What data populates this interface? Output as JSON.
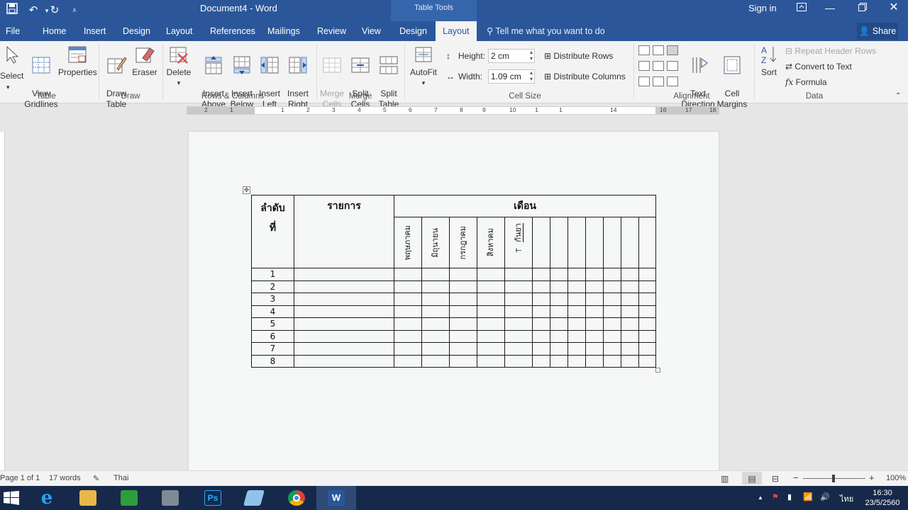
{
  "title_bar": {
    "doc_title": "Document4  -  Word",
    "contextual_label": "Table Tools",
    "signin": "Sign in"
  },
  "tabs": [
    "File",
    "Home",
    "Insert",
    "Design",
    "Layout",
    "References",
    "Mailings",
    "Review",
    "View",
    "Design",
    "Layout"
  ],
  "active_tab": "Layout",
  "tell_me": "Tell me what you want to do",
  "share": "Share",
  "ribbon": {
    "table": {
      "group": "Table",
      "select": "Select",
      "view_gridlines": "View\nGridlines",
      "properties": "Properties"
    },
    "draw": {
      "group": "Draw",
      "draw_table": "Draw\nTable",
      "eraser": "Eraser"
    },
    "rows_cols": {
      "group": "Rows & Columns",
      "delete": "Delete",
      "insert_above": "Insert\nAbove",
      "insert_below": "Insert\nBelow",
      "insert_left": "Insert\nLeft",
      "insert_right": "Insert\nRight"
    },
    "merge": {
      "group": "Merge",
      "merge_cells": "Merge\nCells",
      "split_cells": "Split\nCells",
      "split_table": "Split\nTable"
    },
    "cell_size": {
      "group": "Cell Size",
      "autofit": "AutoFit",
      "height_label": "Height:",
      "height_value": "2 cm",
      "width_label": "Width:",
      "width_value": "1.09 cm",
      "distribute_rows": "Distribute Rows",
      "distribute_columns": "Distribute Columns"
    },
    "alignment": {
      "group": "Alignment",
      "text_direction": "Text\nDirection",
      "cell_margins": "Cell\nMargins"
    },
    "data": {
      "group": "Data",
      "sort": "Sort",
      "repeat_header_rows": "Repeat Header Rows",
      "convert_to_text": "Convert to Text",
      "formula": "Formula"
    }
  },
  "ruler_marks": [
    "2",
    "1",
    "1",
    "2",
    "3",
    "4",
    "5",
    "6",
    "7",
    "8",
    "9",
    "10",
    "1",
    "1",
    "14",
    "16",
    "17",
    "18"
  ],
  "table": {
    "col1_header": "ลำดับ\nที่",
    "col2_header": "รายการ",
    "month_header": "เดือน",
    "month_subheaders": [
      "พฤษภาคม",
      "มิถุนายน",
      "กรกฎาคม",
      "สิงหาคม",
      "กันยา"
    ],
    "rows": [
      "1",
      "2",
      "3",
      "4",
      "5",
      "6",
      "7",
      "8"
    ]
  },
  "status_bar": {
    "page": "Page 1 of 1",
    "words": "17 words",
    "language": "Thai",
    "zoom": "100%"
  },
  "taskbar": {
    "apps": [
      "start-icon",
      "internet-explorer-icon",
      "file-explorer-icon",
      "store-icon",
      "calculator-icon",
      "photoshop-icon",
      "app-icon",
      "chrome-icon",
      "word-icon"
    ],
    "ime": "ไทย",
    "time": "16:30",
    "date": "23/5/2560"
  }
}
